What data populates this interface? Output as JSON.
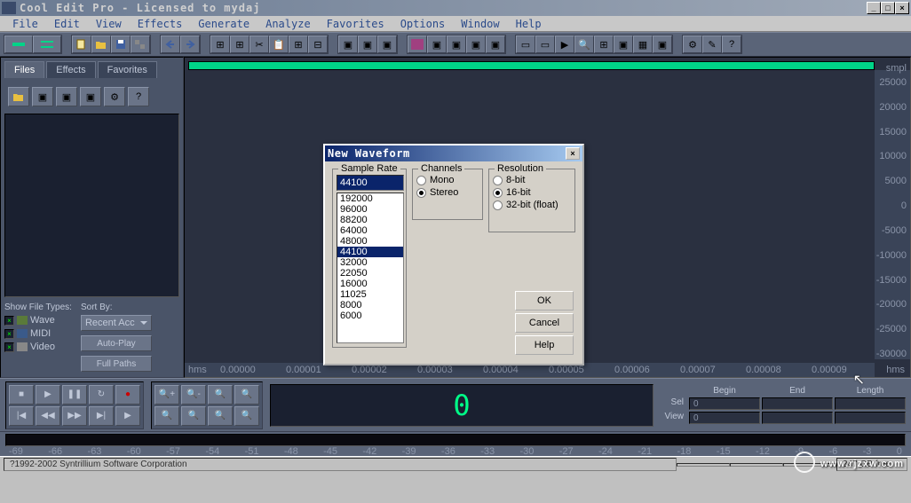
{
  "window": {
    "title": "Cool Edit Pro  - Licensed to mydaj"
  },
  "menu": [
    "File",
    "Edit",
    "View",
    "Effects",
    "Generate",
    "Analyze",
    "Favorites",
    "Options",
    "Window",
    "Help"
  ],
  "sidebar": {
    "tabs": [
      "Files",
      "Effects",
      "Favorites"
    ],
    "activeTab": 0,
    "showFileTypes": "Show File Types:",
    "sortBy": "Sort By:",
    "types": [
      {
        "label": "Wave",
        "checked": true
      },
      {
        "label": "MIDI",
        "checked": true
      },
      {
        "label": "Video",
        "checked": true
      }
    ],
    "sortButtons": [
      "Recent Acc",
      "Auto-Play",
      "Full Paths"
    ]
  },
  "ruler": {
    "unit": "smpl",
    "rightTicks": [
      25000,
      20000,
      15000,
      10000,
      5000,
      0,
      -5000,
      -10000,
      -15000,
      -20000,
      -25000,
      -30000
    ],
    "bottomHms": "hms",
    "bottomTicks": [
      "0.00000",
      "0.00001",
      "0.00002",
      "0.00003",
      "0.00004",
      "0.00005",
      "0.00006",
      "0.00007",
      "0.00008",
      "0.00009"
    ]
  },
  "transport": {
    "time": "0"
  },
  "selection": {
    "headers": [
      "Begin",
      "End",
      "Length"
    ],
    "rows": [
      {
        "label": "Sel",
        "begin": "0",
        "end": "",
        "length": ""
      },
      {
        "label": "View",
        "begin": "0",
        "end": "",
        "length": ""
      }
    ]
  },
  "meter": {
    "ticks": [
      "-69",
      "-66",
      "-63",
      "-60",
      "-57",
      "-54",
      "-51",
      "-48",
      "-45",
      "-42",
      "-39",
      "-36",
      "-33",
      "-30",
      "-27",
      "-24",
      "-21",
      "-18",
      "-15",
      "-12",
      "-9",
      "-6",
      "-3",
      "0"
    ]
  },
  "status": {
    "copyright": "?1992-2002 Syntrillium Software Corporation",
    "disk": "247 GB free"
  },
  "dialog": {
    "title": "New Waveform",
    "sampleRate": {
      "legend": "Sample Rate",
      "value": "44100",
      "options": [
        "192000",
        "96000",
        "88200",
        "64000",
        "48000",
        "44100",
        "32000",
        "22050",
        "16000",
        "11025",
        "8000",
        "6000"
      ],
      "selected": "44100"
    },
    "channels": {
      "legend": "Channels",
      "options": [
        "Mono",
        "Stereo"
      ],
      "selected": "Stereo"
    },
    "resolution": {
      "legend": "Resolution",
      "options": [
        "8-bit",
        "16-bit",
        "32-bit (float)"
      ],
      "selected": "16-bit"
    },
    "buttons": [
      "OK",
      "Cancel",
      "Help"
    ]
  },
  "watermark": "www.rjzxw.com"
}
